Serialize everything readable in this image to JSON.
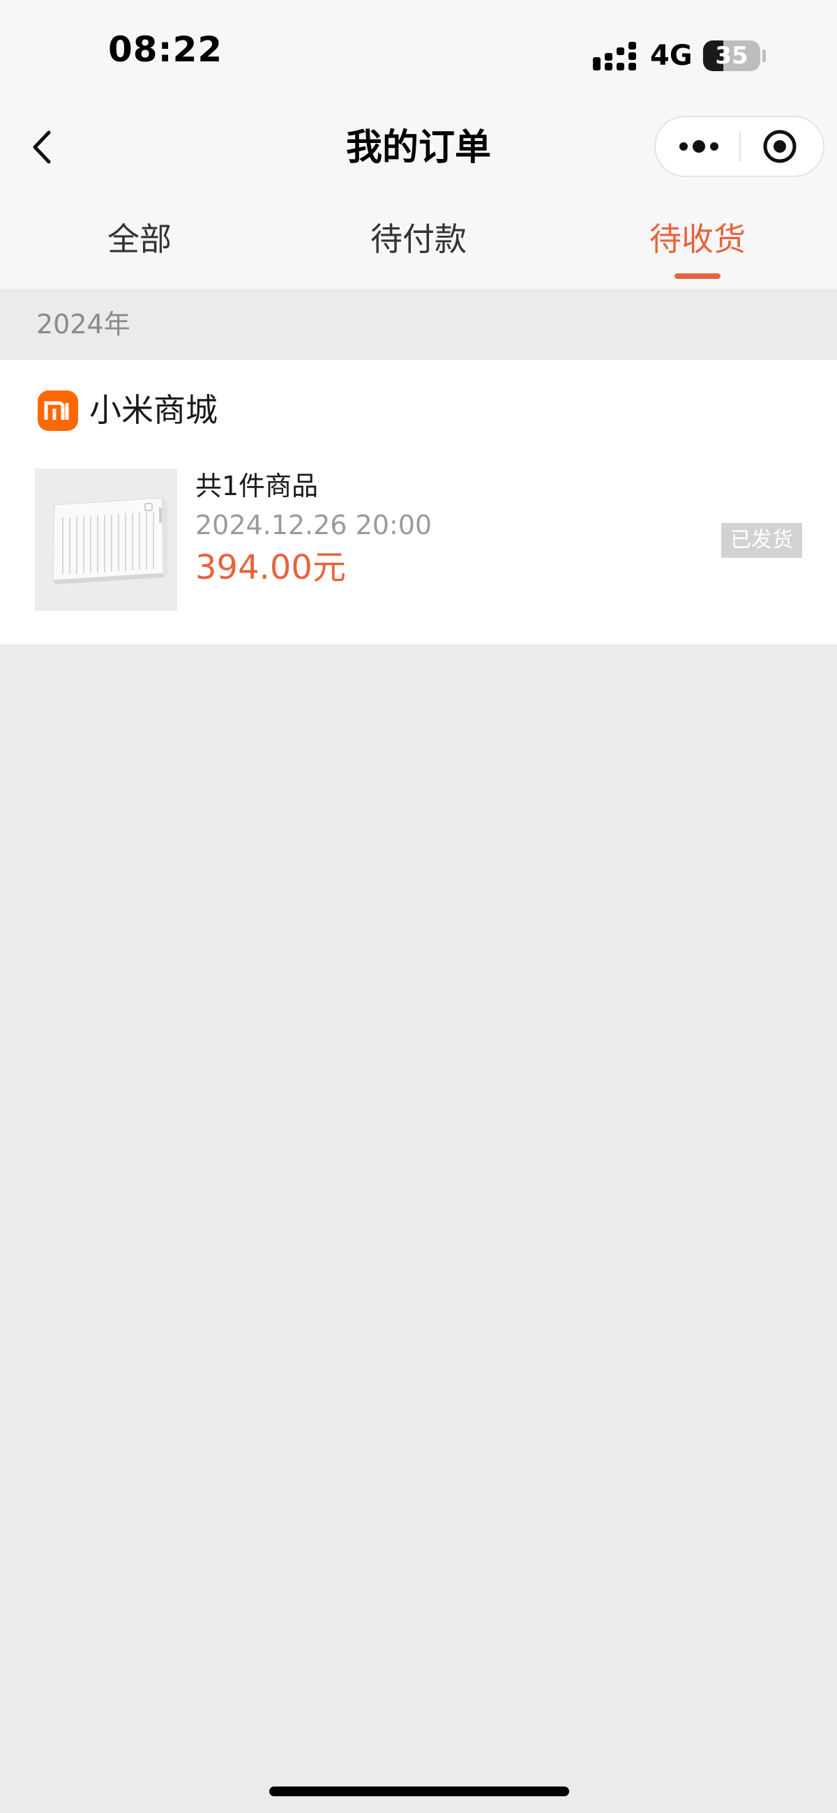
{
  "status_bar": {
    "time": "08:22",
    "network": "4G",
    "battery_percent": "35",
    "battery_level": 0.35,
    "signal_icon": "signal-bars-icon"
  },
  "nav": {
    "title": "我的订单",
    "back_icon": "chevron-left-icon",
    "more_icon": "more-dots-icon",
    "close_icon": "target-circle-icon"
  },
  "tabs": [
    {
      "label": "全部",
      "active": false
    },
    {
      "label": "待付款",
      "active": false
    },
    {
      "label": "待收货",
      "active": true
    }
  ],
  "year_label": "2024年",
  "order": {
    "store_name": "小米商城",
    "store_logo_text": "mi",
    "item_count": "共1件商品",
    "order_time": "2024.12.26 20:00",
    "price": "394.00元",
    "status": "已发货",
    "product_image": "air-purifier-device"
  },
  "colors": {
    "accent": "#e8633c",
    "brand_orange": "#ff6700",
    "page_bg": "#ebebeb",
    "header_bg": "#f7f7f7"
  }
}
